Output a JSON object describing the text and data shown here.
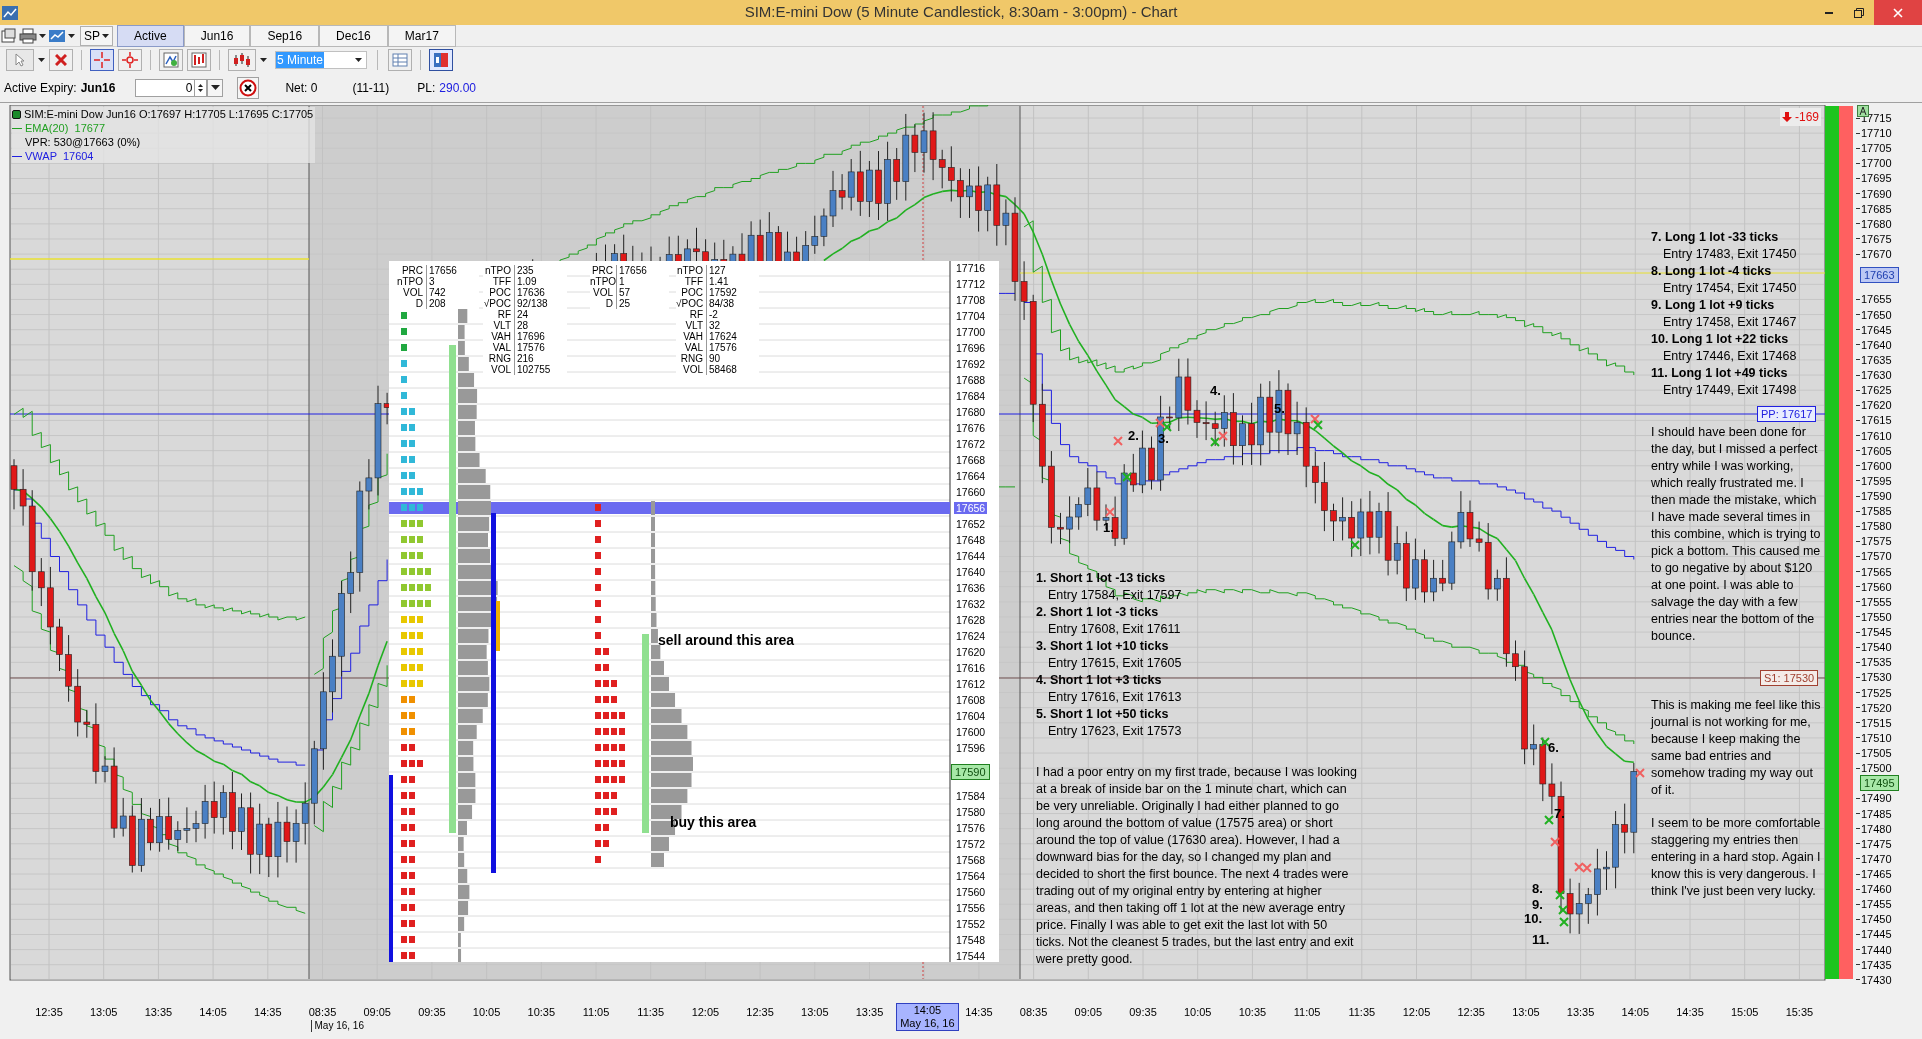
{
  "window": {
    "title": "SIM:E-mini Dow (5 Minute Candlestick, 8:30am - 3:00pm) - Chart"
  },
  "toolbar": {
    "symbol": "SP",
    "tabs": [
      {
        "label": "Active",
        "selected": true
      },
      {
        "label": "Jun16",
        "selected": false
      },
      {
        "label": "Sep16",
        "selected": false
      },
      {
        "label": "Dec16",
        "selected": false
      },
      {
        "label": "Mar17",
        "selected": false
      }
    ],
    "interval": "5 Minute"
  },
  "order_bar": {
    "expiry_label": "Active Expiry:",
    "expiry": "Jun16",
    "quantity": "0",
    "net": "Net: 0",
    "range": "(11-11)",
    "pl_label": "PL:",
    "pl_value": "290.00"
  },
  "legend": [
    {
      "text": "SIM:E-mini Dow Jun16 O:17697 H:17705 L:17695 C:17705",
      "kind": "instrument",
      "color": "#000000"
    },
    {
      "text": "EMA(20)  17677",
      "kind": "line",
      "color": "#22a022"
    },
    {
      "text": "VPR: 530@17663 (0%)",
      "kind": "plain",
      "color": "#000000"
    },
    {
      "text": "VWAP  17604",
      "kind": "line",
      "color": "#2020e0"
    }
  ],
  "price_axis": {
    "labels": [
      "17715",
      "17710",
      "17705",
      "17700",
      "17695",
      "17690",
      "17685",
      "17680",
      "17675",
      "17670",
      "17655",
      "17650",
      "17645",
      "17640",
      "17635",
      "17630",
      "17625",
      "17620",
      "17615",
      "17610",
      "17605",
      "17600",
      "17595",
      "17590",
      "17585",
      "17580",
      "17575",
      "17570",
      "17565",
      "17560",
      "17555",
      "17550",
      "17545",
      "17540",
      "17535",
      "17530",
      "17525",
      "17520",
      "17515",
      "17510",
      "17505",
      "17500",
      "17490",
      "17485",
      "17480",
      "17475",
      "17470",
      "17465",
      "17460",
      "17455",
      "17450",
      "17445",
      "17440",
      "17435",
      "17430"
    ]
  },
  "price_markers": [
    {
      "text": "17663",
      "kind": "last"
    },
    {
      "text": "PP: 17617",
      "kind": "pivot"
    },
    {
      "text": "S1: 17530",
      "kind": "support"
    },
    {
      "text": "17495",
      "kind": "average"
    }
  ],
  "pnl_flag": {
    "text": "-169"
  },
  "tpo_panel": {
    "stats": [
      [
        {
          "label": "PRC",
          "value": "17656"
        },
        {
          "label": "nTPO",
          "value": "3"
        },
        {
          "label": "VOL",
          "value": "742"
        },
        {
          "label": "D",
          "value": "208"
        }
      ],
      [
        {
          "label": "nTPO",
          "value": "235"
        },
        {
          "label": "TFF",
          "value": "1.09"
        },
        {
          "label": "POC",
          "value": "17636"
        },
        {
          "label": "√POC",
          "value": "92/138"
        },
        {
          "label": "RF",
          "value": "24"
        },
        {
          "label": "VLT",
          "value": "28"
        },
        {
          "label": "VAH",
          "value": "17696"
        },
        {
          "label": "VAL",
          "value": "17576"
        },
        {
          "label": "RNG",
          "value": "216"
        },
        {
          "label": "VOL",
          "value": "102755"
        }
      ],
      [
        {
          "label": "PRC",
          "value": "17656"
        },
        {
          "label": "nTPO",
          "value": "1"
        },
        {
          "label": "VOL",
          "value": "57"
        },
        {
          "label": "D",
          "value": "25"
        }
      ],
      [
        {
          "label": "nTPO",
          "value": "127"
        },
        {
          "label": "TFF",
          "value": "1.41"
        },
        {
          "label": "POC",
          "value": "17592"
        },
        {
          "label": "√POC",
          "value": "84/38"
        },
        {
          "label": "RF",
          "value": "-2"
        },
        {
          "label": "VLT",
          "value": "32"
        },
        {
          "label": "VAH",
          "value": "17624"
        },
        {
          "label": "VAL",
          "value": "17576"
        },
        {
          "label": "RNG",
          "value": "90"
        },
        {
          "label": "VOL",
          "value": "58468"
        }
      ]
    ],
    "price_labels": [
      "17716",
      "17712",
      "17708",
      "17704",
      "17700",
      "17696",
      "17692",
      "17688",
      "17684",
      "17680",
      "17676",
      "17672",
      "17668",
      "17664",
      "17660",
      "17656",
      "17652",
      "17648",
      "17644",
      "17640",
      "17636",
      "17632",
      "17628",
      "17624",
      "17620",
      "17616",
      "17612",
      "17608",
      "17604",
      "17600",
      "17596",
      "17584",
      "17580",
      "17576",
      "17572",
      "17568",
      "17564",
      "17560",
      "17556",
      "17552",
      "17548",
      "17544"
    ],
    "marker": "17590",
    "notes": [
      "sell around this area",
      "buy this area"
    ]
  },
  "trade_labels": [
    "1.",
    "2.",
    "3.",
    "4.",
    "5.",
    "6.",
    "7.",
    "8.",
    "9.",
    "10.",
    "11."
  ],
  "notes_left": {
    "trades": [
      {
        "title": "1. Short 1 lot -13 ticks",
        "detail": "Entry 17584, Exit 17597"
      },
      {
        "title": "2. Short 1 lot -3 ticks",
        "detail": "Entry 17608, Exit 17611"
      },
      {
        "title": "3. Short 1 lot +10 ticks",
        "detail": "Entry 17615, Exit 17605"
      },
      {
        "title": "4. Short 1 lot +3 ticks",
        "detail": "Entry 17616, Exit 17613"
      },
      {
        "title": "5. Short 1 lot +50 ticks",
        "detail": "Entry 17623, Exit 17573"
      }
    ],
    "paragraphs": [
      "I had a poor entry on my first trade, because I was looking at a break of inside bar on the 1 minute chart, which can be very unreliable. Originally I had either planned to go long around the bottom of value (17575 area) or short around the top of value (17630 area). However, I had a downward bias for the day, so I changed my plan and decided to short the first bounce.  The next 4 trades were trading out of my original entry by entering at higher areas, and then taking off 1 lot at the new average entry price. Finally I was able to get exit the last lot with 50 ticks. Not the cleanest 5 trades, but the last entry and exit were pretty good."
    ]
  },
  "notes_right": {
    "trades": [
      {
        "title": "7. Long 1 lot -33 ticks",
        "detail": "Entry 17483, Exit 17450"
      },
      {
        "title": "8. Long 1 lot -4 ticks",
        "detail": "Entry 17454, Exit 17450"
      },
      {
        "title": "9. Long 1 lot +9 ticks",
        "detail": "Entry 17458, Exit 17467"
      },
      {
        "title": "10. Long 1 lot +22 ticks",
        "detail": "Entry 17446, Exit 17468"
      },
      {
        "title": "11. Long 1 lot +49 ticks",
        "detail": "Entry 17449, Exit 17498"
      }
    ],
    "paragraphs": [
      "I should have been done for the day, but I missed a perfect entry while I was working, which really frustrated me. I then made the mistake, which I have made several times in this combine, which is trying to pick a bottom. This caused me to go negative by about $120 at one point. I was able to salvage the day with a few entries near the bottom of the bounce.",
      "This is making me feel like this journal is not working for me, because I keep making the same bad entries and somehow trading my way out of it.",
      "I seem to be more comfortable staggering my entries then entering in a hard stop. Again I know this is very dangerous. I think I've just been very lucky."
    ]
  },
  "time_axis": [
    {
      "text": "12:35",
      "kind": "tick"
    },
    {
      "text": "13:05",
      "kind": "tick"
    },
    {
      "text": "13:35",
      "kind": "tick"
    },
    {
      "text": "14:05",
      "kind": "tick"
    },
    {
      "text": "14:35",
      "kind": "tick"
    },
    {
      "text": "08:35",
      "kind": "session",
      "date": "May 16, 16"
    },
    {
      "text": "09:05",
      "kind": "tick"
    },
    {
      "text": "09:35",
      "kind": "tick"
    },
    {
      "text": "10:05",
      "kind": "tick"
    },
    {
      "text": "10:35",
      "kind": "tick"
    },
    {
      "text": "11:05",
      "kind": "tick"
    },
    {
      "text": "11:35",
      "kind": "tick"
    },
    {
      "text": "12:05",
      "kind": "tick"
    },
    {
      "text": "12:35",
      "kind": "tick"
    },
    {
      "text": "13:05",
      "kind": "tick"
    },
    {
      "text": "13:35",
      "kind": "tick"
    },
    {
      "text": "14:05",
      "kind": "cursor",
      "date": "May 16, 16"
    },
    {
      "text": "14:35",
      "kind": "tick"
    },
    {
      "text": "08:35",
      "kind": "tick"
    },
    {
      "text": "09:05",
      "kind": "tick"
    },
    {
      "text": "09:35",
      "kind": "tick"
    },
    {
      "text": "10:05",
      "kind": "tick"
    },
    {
      "text": "10:35",
      "kind": "tick"
    },
    {
      "text": "11:05",
      "kind": "tick"
    },
    {
      "text": "11:35",
      "kind": "tick"
    },
    {
      "text": "12:05",
      "kind": "tick"
    },
    {
      "text": "12:35",
      "kind": "tick"
    },
    {
      "text": "13:05",
      "kind": "tick"
    },
    {
      "text": "13:35",
      "kind": "tick"
    },
    {
      "text": "14:05",
      "kind": "tick"
    },
    {
      "text": "14:35",
      "kind": "tick"
    },
    {
      "text": "15:05",
      "kind": "tick"
    },
    {
      "text": "15:35",
      "kind": "tick"
    }
  ]
}
